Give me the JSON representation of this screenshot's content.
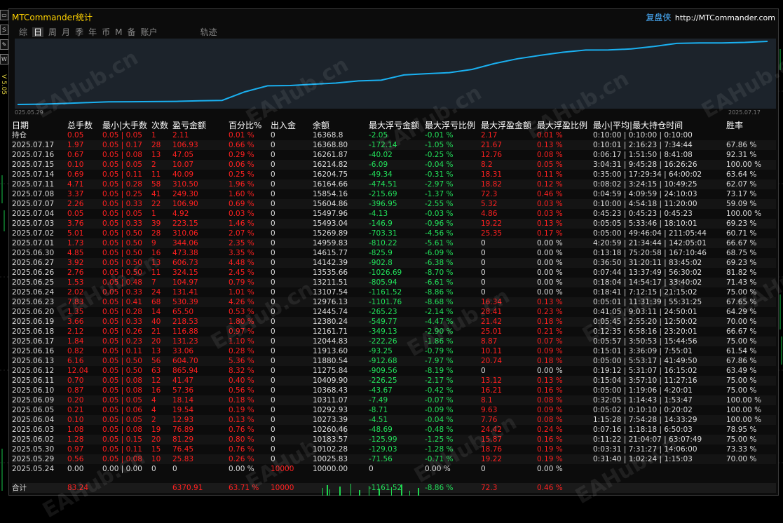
{
  "app": {
    "title": "MTCommander统计",
    "brand_cn": "复盘侠",
    "brand_url": "http://MTCommander.com",
    "side_version": "V 5.05"
  },
  "side_icons": [
    "rect-tool-icon",
    "image-tool-icon",
    "edit-tool-icon",
    "label-tool-icon"
  ],
  "side_icon_glyphs": [
    "▭",
    "彡",
    "✎",
    "W"
  ],
  "tabs": [
    {
      "label": "综",
      "active": false
    },
    {
      "label": "日",
      "active": true
    },
    {
      "label": "周",
      "active": false
    },
    {
      "label": "月",
      "active": false
    },
    {
      "label": "季",
      "active": false
    },
    {
      "label": "年",
      "active": false
    },
    {
      "label": "币",
      "active": false
    },
    {
      "label": "M",
      "active": false
    },
    {
      "label": "备",
      "active": false
    },
    {
      "label": "账户",
      "active": false
    }
  ],
  "track_tab": "轨迹",
  "equity_chart": {
    "start_label": "025.05.29",
    "end_label": "2025.07.17",
    "line_color": "#1ab0f0",
    "balances": [
      10000.0,
      10025.83,
      10102.28,
      10183.57,
      10260.46,
      10273.39,
      10292.93,
      10311.07,
      10368.43,
      10409.9,
      11275.84,
      11880.54,
      11913.6,
      12044.83,
      12161.71,
      12380.24,
      12445.74,
      12976.13,
      13107.54,
      13211.51,
      13535.66,
      14142.39,
      14615.77,
      14959.83,
      15269.89,
      15493.04,
      15497.96,
      15604.86,
      15854.16,
      16164.66,
      16204.75,
      16214.82,
      16261.87,
      16368.8
    ]
  },
  "watermark": "EAHub.cn",
  "columns": [
    "日期",
    "总手数",
    "最小|大手数",
    "次数",
    "盈亏金额",
    "百分比%",
    "出入金",
    "余额",
    "最大浮亏金额",
    "最大浮亏比例",
    "最大浮盈金额",
    "最大浮盈比例",
    "最小|平均|最大持仓时间",
    "胜率"
  ],
  "rows": [
    [
      "持仓",
      "0.05",
      "0.05 | 0.05",
      "1",
      "2.11",
      "0.01 %",
      "0",
      "16368.8",
      "-2.05",
      "-0.01 %",
      "2.17",
      "0.01 %",
      "0:10:00 | 0:10:00 | 0:10:00",
      ""
    ],
    [
      "2025.07.17",
      "1.97",
      "0.05 | 0.17",
      "28",
      "106.93",
      "0.66 %",
      "0",
      "16368.80",
      "-172.14",
      "-1.05 %",
      "21.67",
      "0.13 %",
      "0:10:01 | 2:16:23 | 7:34:44",
      "67.86 %"
    ],
    [
      "2025.07.16",
      "0.67",
      "0.05 | 0.08",
      "13",
      "47.05",
      "0.29 %",
      "0",
      "16261.87",
      "-40.02",
      "-0.25 %",
      "12.76",
      "0.08 %",
      "0:06:17 | 1:51:50 | 8:41:08",
      "92.31 %"
    ],
    [
      "2025.07.15",
      "0.10",
      "0.05 | 0.05",
      "2",
      "10.07",
      "0.06 %",
      "0",
      "16214.82",
      "-6.09",
      "-0.04 %",
      "8.2",
      "0.05 %",
      "3:04:31 | 9:45:28 | 16:26:26",
      "100.00 %"
    ],
    [
      "2025.07.14",
      "0.69",
      "0.05 | 0.11",
      "11",
      "40.09",
      "0.25 %",
      "0",
      "16204.75",
      "-49.34",
      "-0.31 %",
      "18.31",
      "0.11 %",
      "0:35:00 | 17:29:34 | 64:00:02",
      "63.64 %"
    ],
    [
      "2025.07.11",
      "4.71",
      "0.05 | 0.28",
      "58",
      "310.50",
      "1.96 %",
      "0",
      "16164.66",
      "-474.51",
      "-2.97 %",
      "18.82",
      "0.12 %",
      "0:08:02 | 3:24:15 | 10:49:25",
      "62.07 %"
    ],
    [
      "2025.07.08",
      "3.37",
      "0.05 | 0.25",
      "41",
      "249.30",
      "1.60 %",
      "0",
      "15854.16",
      "-215.69",
      "-1.37 %",
      "72.3",
      "0.46 %",
      "0:04:59 | 4:09:59 | 24:10:03",
      "73.17 %"
    ],
    [
      "2025.07.07",
      "2.26",
      "0.05 | 0.33",
      "22",
      "106.90",
      "0.69 %",
      "0",
      "15604.86",
      "-396.95",
      "-2.55 %",
      "5.32",
      "0.03 %",
      "0:10:00 | 4:54:18 | 11:20:00",
      "59.09 %"
    ],
    [
      "2025.07.04",
      "0.05",
      "0.05 | 0.05",
      "1",
      "4.92",
      "0.03 %",
      "0",
      "15497.96",
      "-4.13",
      "-0.03 %",
      "4.86",
      "0.03 %",
      "0:45:23 | 0:45:23 | 0:45:23",
      "100.00 %"
    ],
    [
      "2025.07.03",
      "3.76",
      "0.05 | 0.33",
      "39",
      "223.15",
      "1.46 %",
      "0",
      "15493.04",
      "-146.9",
      "-0.96 %",
      "19.22",
      "0.13 %",
      "0:05:05 | 5:33:46 | 18:10:01",
      "69.23 %"
    ],
    [
      "2025.07.02",
      "5.01",
      "0.05 | 0.50",
      "28",
      "310.06",
      "2.07 %",
      "0",
      "15269.89",
      "-703.31",
      "-4.56 %",
      "25.35",
      "0.17 %",
      "0:05:00 | 49:46:04 | 211:05:44",
      "60.71 %"
    ],
    [
      "2025.07.01",
      "1.73",
      "0.05 | 0.50",
      "9",
      "344.06",
      "2.35 %",
      "0",
      "14959.83",
      "-810.22",
      "-5.61 %",
      "0",
      "0.00 %",
      "4:20:59 | 21:34:44 | 142:05:01",
      "66.67 %"
    ],
    [
      "2025.06.30",
      "4.85",
      "0.05 | 0.50",
      "16",
      "473.38",
      "3.35 %",
      "0",
      "14615.77",
      "-825.9",
      "-6.09 %",
      "0",
      "0.00 %",
      "0:13:18 | 75:20:58 | 167:10:46",
      "68.75 %"
    ],
    [
      "2025.06.27",
      "3.92",
      "0.05 | 0.50",
      "13",
      "606.73",
      "4.48 %",
      "0",
      "14142.39",
      "-902.8",
      "-6.38 %",
      "0",
      "0.00 %",
      "0:36:50 | 31:20:11 | 83:45:02",
      "69.23 %"
    ],
    [
      "2025.06.26",
      "2.76",
      "0.05 | 0.50",
      "11",
      "324.15",
      "2.45 %",
      "0",
      "13535.66",
      "-1026.69",
      "-8.70 %",
      "0",
      "0.00 %",
      "0:07:44 | 13:37:49 | 56:30:02",
      "81.82 %"
    ],
    [
      "2025.06.25",
      "1.53",
      "0.05 | 0.48",
      "7",
      "104.97",
      "0.79 %",
      "0",
      "13211.51",
      "-805.94",
      "-6.61 %",
      "0",
      "0.00 %",
      "0:18:04 | 14:54:17 | 33:40:02",
      "71.43 %"
    ],
    [
      "2025.06.24",
      "2.02",
      "0.05 | 0.33",
      "24",
      "131.41",
      "1.01 %",
      "0",
      "13107.54",
      "-1161.52",
      "-8.86 %",
      "0",
      "0.00 %",
      "0:18:41 | 7:12:15 | 21:15:02",
      "75.00 %"
    ],
    [
      "2025.06.23",
      "7.83",
      "0.05 | 0.41",
      "68",
      "530.39",
      "4.26 %",
      "0",
      "12976.13",
      "-1101.76",
      "-8.68 %",
      "16.34",
      "0.13 %",
      "0:05:01 | 11:31:39 | 55:31:25",
      "67.65 %"
    ],
    [
      "2025.06.20",
      "1.35",
      "0.05 | 0.28",
      "14",
      "65.50",
      "0.53 %",
      "0",
      "12445.74",
      "-265.23",
      "-2.14 %",
      "28.41",
      "0.23 %",
      "0:41:05 | 9:03:11 | 24:50:01",
      "64.29 %"
    ],
    [
      "2025.06.19",
      "3.66",
      "0.05 | 0.33",
      "40",
      "218.53",
      "1.80 %",
      "0",
      "12380.24",
      "-549.77",
      "-4.47 %",
      "21.42",
      "0.18 %",
      "0:05:45 | 2:55:20 | 12:50:02",
      "70.00 %"
    ],
    [
      "2025.06.18",
      "2.12",
      "0.05 | 0.26",
      "21",
      "116.88",
      "0.97 %",
      "0",
      "12161.71",
      "-349.13",
      "-2.90 %",
      "25.01",
      "0.21 %",
      "0:12:35 | 6:58:16 | 23:20:01",
      "66.67 %"
    ],
    [
      "2025.06.17",
      "1.84",
      "0.05 | 0.23",
      "20",
      "131.23",
      "1.10 %",
      "0",
      "12044.83",
      "-222.26",
      "-1.86 %",
      "8.87",
      "0.07 %",
      "0:05:57 | 3:50:53 | 15:44:56",
      "75.00 %"
    ],
    [
      "2025.06.16",
      "0.82",
      "0.05 | 0.11",
      "13",
      "33.06",
      "0.28 %",
      "0",
      "11913.60",
      "-93.25",
      "-0.79 %",
      "10.11",
      "0.09 %",
      "0:15:01 | 3:36:09 | 7:55:01",
      "61.54 %"
    ],
    [
      "2025.06.13",
      "6.16",
      "0.05 | 0.50",
      "56",
      "604.70",
      "5.36 %",
      "0",
      "11880.54",
      "-912.68",
      "-7.97 %",
      "20.74",
      "0.18 %",
      "0:05:00 | 5:53:17 | 41:49:50",
      "67.86 %"
    ],
    [
      "2025.06.12",
      "12.04",
      "0.05 | 0.50",
      "63",
      "865.94",
      "8.32 %",
      "0",
      "11275.84",
      "-909.56",
      "-8.19 %",
      "0",
      "0.00 %",
      "0:19:12 | 5:31:07 | 16:15:02",
      "63.49 %"
    ],
    [
      "2025.06.11",
      "0.70",
      "0.05 | 0.08",
      "12",
      "41.47",
      "0.40 %",
      "0",
      "10409.90",
      "-226.25",
      "-2.17 %",
      "13.12",
      "0.13 %",
      "0:15:04 | 3:57:10 | 11:27:16",
      "75.00 %"
    ],
    [
      "2025.06.10",
      "0.87",
      "0.05 | 0.08",
      "16",
      "57.36",
      "0.56 %",
      "0",
      "10368.43",
      "-43.67",
      "-0.42 %",
      "16.21",
      "0.16 %",
      "0:05:00 | 1:19:06 | 4:20:01",
      "75.00 %"
    ],
    [
      "2025.06.09",
      "0.20",
      "0.05 | 0.05",
      "4",
      "18.14",
      "0.18 %",
      "0",
      "10311.07",
      "-7.49",
      "-0.07 %",
      "8.1",
      "0.08 %",
      "0:32:05 | 1:14:43 | 1:53:47",
      "100.00 %"
    ],
    [
      "2025.06.05",
      "0.21",
      "0.05 | 0.06",
      "4",
      "19.54",
      "0.19 %",
      "0",
      "10292.93",
      "-8.71",
      "-0.09 %",
      "9.63",
      "0.09 %",
      "0:05:02 | 0:10:10 | 0:20:02",
      "100.00 %"
    ],
    [
      "2025.06.04",
      "0.10",
      "0.05 | 0.05",
      "2",
      "12.93",
      "0.13 %",
      "0",
      "10273.39",
      "-4.51",
      "-0.04 %",
      "7.76",
      "0.08 %",
      "1:15:28 | 7:54:28 | 14:33:29",
      "100.00 %"
    ],
    [
      "2025.06.03",
      "1.08",
      "0.05 | 0.08",
      "19",
      "76.89",
      "0.76 %",
      "0",
      "10260.46",
      "-48.69",
      "-0.48 %",
      "24.42",
      "0.24 %",
      "0:07:16 | 1:18:18 | 6:50:03",
      "78.95 %"
    ],
    [
      "2025.06.02",
      "1.28",
      "0.05 | 0.15",
      "20",
      "81.29",
      "0.80 %",
      "0",
      "10183.57",
      "-125.99",
      "-1.25 %",
      "15.87",
      "0.16 %",
      "0:11:22 | 21:04:07 | 63:07:49",
      "75.00 %"
    ],
    [
      "2025.05.30",
      "0.97",
      "0.05 | 0.11",
      "15",
      "76.45",
      "0.76 %",
      "0",
      "10102.28",
      "-129.03",
      "-1.28 %",
      "18.76",
      "0.19 %",
      "0:03:31 | 7:31:27 | 14:06:00",
      "73.33 %"
    ],
    [
      "2025.05.29",
      "0.56",
      "0.05 | 0.08",
      "10",
      "25.83",
      "0.26 %",
      "0",
      "10025.83",
      "-71.56",
      "-0.71 %",
      "19.22",
      "0.19 %",
      "0:31:40 | 1:02:24 | 1:15:03",
      "70.00 %"
    ],
    [
      "2025.05.24",
      "0.00",
      "0.00 | 0.00",
      "0",
      "0",
      "0.00 %",
      "10000",
      "10000.00",
      "0",
      "0.00 %",
      "0",
      "0.00 %",
      "",
      ""
    ]
  ],
  "total": {
    "label": "合计",
    "total_lots": "83.24",
    "pl": "6370.91",
    "pct": "63.71 %",
    "deposit": "10000",
    "max_dd": "-1161.52",
    "max_dd_pct": "-8.86 %",
    "max_fp": "72.3",
    "max_fp_pct": "0.46 %"
  },
  "colors": {
    "title": "#ffd200",
    "profit": "#ff2020",
    "loss": "#22e05a",
    "neutral": "#dddddd",
    "brand": "#4ab0ff"
  }
}
